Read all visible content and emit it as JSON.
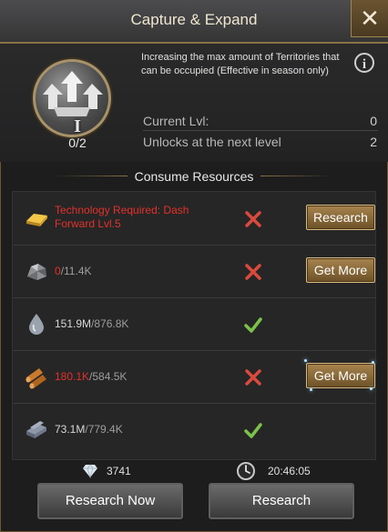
{
  "header": {
    "title": "Capture & Expand",
    "close_icon": "close-icon",
    "close_glyph": "✕"
  },
  "skill": {
    "icon": "expand-arrows-icon",
    "level_roman": "I",
    "progress": "0/2",
    "description": "Increasing the max amount of Territories that can be occupied (Effective in season only)",
    "info_glyph": "i",
    "current_level_label": "Current Lvl:",
    "current_level_value": "0",
    "next_unlock_label": "Unlocks at the next level",
    "next_unlock_value": "2"
  },
  "resources_section": {
    "title": "Consume Resources",
    "rows": [
      {
        "icon": "gold-bar-icon",
        "requirement": "Technology Required: Dash Forward Lvl.5",
        "status": "missing",
        "button": "Research"
      },
      {
        "icon": "iron-ore-icon",
        "have": "0",
        "need": "/11.4K",
        "status": "missing",
        "button": "Get More"
      },
      {
        "icon": "oil-drop-icon",
        "have": "151.9M",
        "need": "/876.8K",
        "status": "ok"
      },
      {
        "icon": "wood-logs-icon",
        "have": "180.1K",
        "need": "/584.5K",
        "status": "missing",
        "button": "Get More"
      },
      {
        "icon": "steel-bars-icon",
        "have": "73.1M",
        "need": "/779.4K",
        "status": "ok"
      }
    ]
  },
  "footer": {
    "gems_icon": "diamond-icon",
    "gems": "3741",
    "time_icon": "clock-icon",
    "time": "20:46:05",
    "research_now_label": "Research Now",
    "research_label": "Research"
  },
  "colors": {
    "accent_gold": "#a8844e",
    "insufficient_red": "#e3312a",
    "ok_green": "#7cc24a"
  }
}
